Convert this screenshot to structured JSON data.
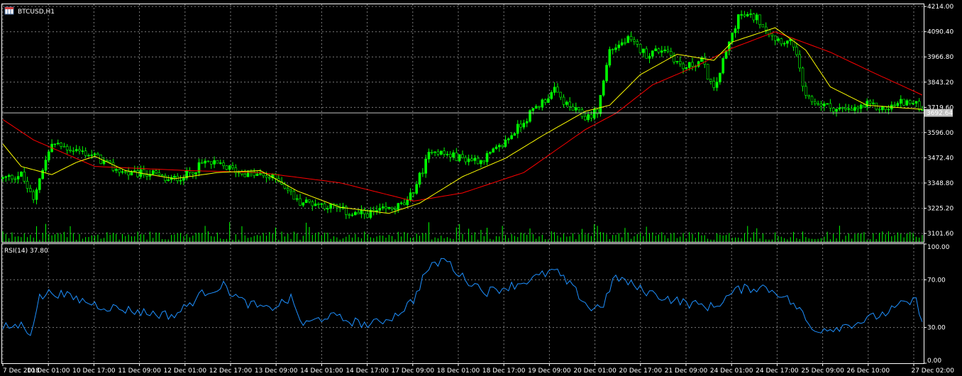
{
  "window": {
    "symbol_timeframe": "BTCUSD,H1"
  },
  "colors": {
    "background": "#000000",
    "grid": "#7a7a7a",
    "text": "#ffffff",
    "candle_wick": "#00ff00",
    "candle_body": "#00ff00",
    "volume": "#00ff00",
    "ma_fast": "#ffff00",
    "ma_slow": "#ff0000",
    "rsi": "#1e90ff",
    "price_line": "#c0c0c0",
    "price_label_bg": "#c0c0c0",
    "price_label_text": "#000000"
  },
  "price_axis_ticks": [
    "4214.00",
    "4090.40",
    "3966.80",
    "3843.20",
    "3719.60",
    "3596.00",
    "3472.40",
    "3348.80",
    "3225.20",
    "3101.60"
  ],
  "current_price_label": "3692.64",
  "rsi_panel": {
    "label": "RSI(14) 37.80",
    "ticks": [
      "100.00",
      "70.00",
      "30.00",
      "0.00"
    ]
  },
  "time_axis_ticks": [
    "7 Dec 2018",
    "10 Dec 01:00",
    "10 Dec 17:00",
    "11 Dec 09:00",
    "12 Dec 01:00",
    "12 Dec 17:00",
    "13 Dec 09:00",
    "14 Dec 01:00",
    "14 Dec 17:00",
    "17 Dec 09:00",
    "18 Dec 01:00",
    "18 Dec 17:00",
    "19 Dec 09:00",
    "20 Dec 01:00",
    "20 Dec 17:00",
    "21 Dec 09:00",
    "24 Dec 01:00",
    "24 Dec 17:00",
    "25 Dec 09:00",
    "26 Dec 10:00",
    "27 Dec 02:00"
  ],
  "chart_data": [
    {
      "type": "candlestick",
      "title": "BTCUSD,H1",
      "ylim": [
        3060,
        4225
      ],
      "price_keypoints": [
        {
          "t": 0,
          "p": 3370
        },
        {
          "t": 6,
          "p": 3390
        },
        {
          "t": 10,
          "p": 3260
        },
        {
          "t": 12,
          "p": 3380
        },
        {
          "t": 16,
          "p": 3540
        },
        {
          "t": 24,
          "p": 3510
        },
        {
          "t": 30,
          "p": 3480
        },
        {
          "t": 36,
          "p": 3420
        },
        {
          "t": 42,
          "p": 3390
        },
        {
          "t": 48,
          "p": 3400
        },
        {
          "t": 54,
          "p": 3360
        },
        {
          "t": 60,
          "p": 3390
        },
        {
          "t": 66,
          "p": 3450
        },
        {
          "t": 72,
          "p": 3430
        },
        {
          "t": 78,
          "p": 3400
        },
        {
          "t": 84,
          "p": 3385
        },
        {
          "t": 90,
          "p": 3370
        },
        {
          "t": 96,
          "p": 3260
        },
        {
          "t": 102,
          "p": 3250
        },
        {
          "t": 108,
          "p": 3230
        },
        {
          "t": 114,
          "p": 3195
        },
        {
          "t": 120,
          "p": 3200
        },
        {
          "t": 126,
          "p": 3220
        },
        {
          "t": 132,
          "p": 3250
        },
        {
          "t": 136,
          "p": 3380
        },
        {
          "t": 140,
          "p": 3520
        },
        {
          "t": 144,
          "p": 3490
        },
        {
          "t": 150,
          "p": 3470
        },
        {
          "t": 156,
          "p": 3460
        },
        {
          "t": 162,
          "p": 3520
        },
        {
          "t": 168,
          "p": 3620
        },
        {
          "t": 174,
          "p": 3720
        },
        {
          "t": 180,
          "p": 3800
        },
        {
          "t": 184,
          "p": 3730
        },
        {
          "t": 190,
          "p": 3670
        },
        {
          "t": 194,
          "p": 3700
        },
        {
          "t": 198,
          "p": 4000
        },
        {
          "t": 204,
          "p": 4050
        },
        {
          "t": 210,
          "p": 3980
        },
        {
          "t": 216,
          "p": 4010
        },
        {
          "t": 222,
          "p": 3910
        },
        {
          "t": 228,
          "p": 3950
        },
        {
          "t": 232,
          "p": 3800
        },
        {
          "t": 236,
          "p": 3990
        },
        {
          "t": 240,
          "p": 4170
        },
        {
          "t": 246,
          "p": 4160
        },
        {
          "t": 252,
          "p": 4060
        },
        {
          "t": 258,
          "p": 4030
        },
        {
          "t": 262,
          "p": 3760
        },
        {
          "t": 270,
          "p": 3720
        },
        {
          "t": 276,
          "p": 3700
        },
        {
          "t": 282,
          "p": 3730
        },
        {
          "t": 288,
          "p": 3710
        },
        {
          "t": 294,
          "p": 3750
        },
        {
          "t": 300,
          "p": 3720
        }
      ],
      "ma_fast_keypoints": [
        {
          "t": 0,
          "p": 3540
        },
        {
          "t": 6,
          "p": 3430
        },
        {
          "t": 16,
          "p": 3390
        },
        {
          "t": 24,
          "p": 3450
        },
        {
          "t": 30,
          "p": 3480
        },
        {
          "t": 40,
          "p": 3410
        },
        {
          "t": 56,
          "p": 3370
        },
        {
          "t": 70,
          "p": 3400
        },
        {
          "t": 84,
          "p": 3410
        },
        {
          "t": 96,
          "p": 3310
        },
        {
          "t": 110,
          "p": 3230
        },
        {
          "t": 126,
          "p": 3200
        },
        {
          "t": 136,
          "p": 3250
        },
        {
          "t": 150,
          "p": 3380
        },
        {
          "t": 164,
          "p": 3470
        },
        {
          "t": 176,
          "p": 3580
        },
        {
          "t": 190,
          "p": 3700
        },
        {
          "t": 198,
          "p": 3730
        },
        {
          "t": 208,
          "p": 3880
        },
        {
          "t": 220,
          "p": 3980
        },
        {
          "t": 232,
          "p": 3950
        },
        {
          "t": 238,
          "p": 4040
        },
        {
          "t": 252,
          "p": 4110
        },
        {
          "t": 262,
          "p": 4000
        },
        {
          "t": 270,
          "p": 3820
        },
        {
          "t": 282,
          "p": 3730
        },
        {
          "t": 300,
          "p": 3710
        }
      ],
      "ma_slow_keypoints": [
        {
          "t": 0,
          "p": 3660
        },
        {
          "t": 10,
          "p": 3560
        },
        {
          "t": 30,
          "p": 3430
        },
        {
          "t": 60,
          "p": 3410
        },
        {
          "t": 84,
          "p": 3400
        },
        {
          "t": 110,
          "p": 3350
        },
        {
          "t": 134,
          "p": 3260
        },
        {
          "t": 150,
          "p": 3300
        },
        {
          "t": 170,
          "p": 3400
        },
        {
          "t": 190,
          "p": 3610
        },
        {
          "t": 200,
          "p": 3690
        },
        {
          "t": 212,
          "p": 3830
        },
        {
          "t": 226,
          "p": 3920
        },
        {
          "t": 238,
          "p": 4010
        },
        {
          "t": 252,
          "p": 4090
        },
        {
          "t": 270,
          "p": 3990
        },
        {
          "t": 284,
          "p": 3890
        },
        {
          "t": 300,
          "p": 3780
        }
      ],
      "current_price": 3692.64
    },
    {
      "type": "line",
      "title": "RSI(14) 37.80",
      "ylim": [
        0,
        100
      ],
      "yticks": [
        0,
        30,
        70,
        100
      ],
      "rsi_keypoints": [
        {
          "t": 0,
          "p": 30
        },
        {
          "t": 6,
          "p": 32
        },
        {
          "t": 9,
          "p": 26
        },
        {
          "t": 12,
          "p": 55
        },
        {
          "t": 16,
          "p": 60
        },
        {
          "t": 24,
          "p": 54
        },
        {
          "t": 32,
          "p": 48
        },
        {
          "t": 40,
          "p": 45
        },
        {
          "t": 48,
          "p": 42
        },
        {
          "t": 56,
          "p": 40
        },
        {
          "t": 66,
          "p": 60
        },
        {
          "t": 72,
          "p": 65
        },
        {
          "t": 78,
          "p": 52
        },
        {
          "t": 86,
          "p": 45
        },
        {
          "t": 94,
          "p": 54
        },
        {
          "t": 98,
          "p": 32
        },
        {
          "t": 106,
          "p": 40
        },
        {
          "t": 114,
          "p": 35
        },
        {
          "t": 120,
          "p": 32
        },
        {
          "t": 128,
          "p": 40
        },
        {
          "t": 134,
          "p": 53
        },
        {
          "t": 138,
          "p": 77
        },
        {
          "t": 144,
          "p": 88
        },
        {
          "t": 150,
          "p": 72
        },
        {
          "t": 158,
          "p": 60
        },
        {
          "t": 166,
          "p": 65
        },
        {
          "t": 172,
          "p": 70
        },
        {
          "t": 180,
          "p": 78
        },
        {
          "t": 186,
          "p": 63
        },
        {
          "t": 192,
          "p": 45
        },
        {
          "t": 196,
          "p": 50
        },
        {
          "t": 200,
          "p": 73
        },
        {
          "t": 208,
          "p": 62
        },
        {
          "t": 216,
          "p": 55
        },
        {
          "t": 224,
          "p": 50
        },
        {
          "t": 232,
          "p": 47
        },
        {
          "t": 236,
          "p": 55
        },
        {
          "t": 240,
          "p": 62
        },
        {
          "t": 248,
          "p": 64
        },
        {
          "t": 254,
          "p": 58
        },
        {
          "t": 260,
          "p": 45
        },
        {
          "t": 264,
          "p": 28
        },
        {
          "t": 272,
          "p": 30
        },
        {
          "t": 280,
          "p": 35
        },
        {
          "t": 288,
          "p": 42
        },
        {
          "t": 294,
          "p": 50
        },
        {
          "t": 298,
          "p": 52
        },
        {
          "t": 300,
          "p": 38
        }
      ]
    }
  ]
}
